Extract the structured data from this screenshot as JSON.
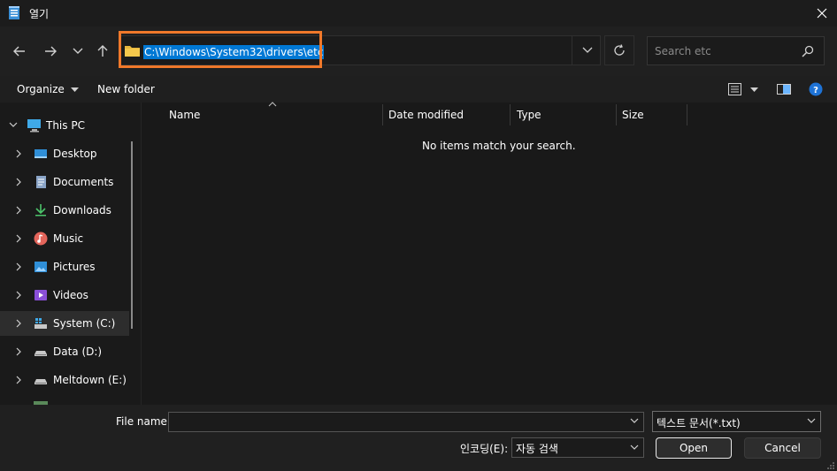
{
  "window": {
    "title": "열기",
    "close_label": "✕"
  },
  "nav": {
    "address_path": "C:\\Windows\\System32\\drivers\\etc",
    "search_placeholder": "Search etc"
  },
  "toolbar": {
    "organize_label": "Organize",
    "new_folder_label": "New folder"
  },
  "sidebar": {
    "items": [
      {
        "label": "This PC",
        "icon": "pc-icon"
      },
      {
        "label": "Desktop",
        "icon": "desktop-icon"
      },
      {
        "label": "Documents",
        "icon": "documents-icon"
      },
      {
        "label": "Downloads",
        "icon": "downloads-icon"
      },
      {
        "label": "Music",
        "icon": "music-icon"
      },
      {
        "label": "Pictures",
        "icon": "pictures-icon"
      },
      {
        "label": "Videos",
        "icon": "videos-icon"
      },
      {
        "label": "System (C:)",
        "icon": "drive-icon"
      },
      {
        "label": "Data (D:)",
        "icon": "drive-icon"
      },
      {
        "label": "Meltdown (E:)",
        "icon": "drive-icon"
      }
    ]
  },
  "content": {
    "columns": [
      "Name",
      "Date modified",
      "Type",
      "Size"
    ],
    "empty_message": "No items match your search."
  },
  "bottom": {
    "file_name_label": "File name:",
    "file_name_value": "",
    "file_type_filter": "텍스트 문서(*.txt)",
    "encoding_label": "인코딩(E):",
    "encoding_value": "자동 검색",
    "open_label": "Open",
    "cancel_label": "Cancel"
  },
  "colors": {
    "accent": "#0078d4",
    "highlight_box": "#f0782a",
    "background": "#191919"
  }
}
